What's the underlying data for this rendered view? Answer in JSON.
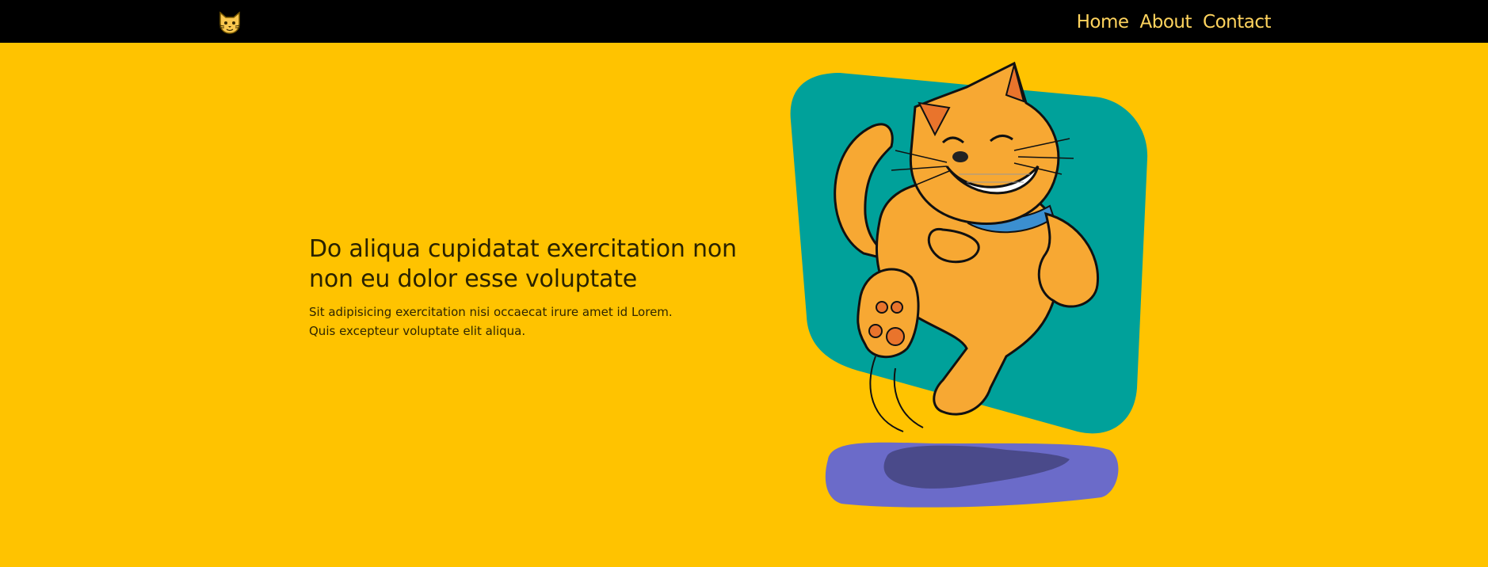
{
  "nav": {
    "logo_icon": "cat-face-icon",
    "links": [
      "Home",
      "About",
      "Contact"
    ]
  },
  "hero": {
    "title": "Do aliqua cupidatat exercitation non non eu dolor esse voluptate",
    "subtitle": "Sit adipisicing exercitation nisi occaecat irure amet id Lorem. Quis excepteur voluptate elit aliqua.",
    "illustration": "dancing-cat-illustration"
  },
  "colors": {
    "background": "#FFC300",
    "navbar": "#000000",
    "nav_link": "#FFD45E",
    "teal_panel": "#00A19A",
    "cat_orange": "#F7A833",
    "shadow_purple": "#6B6BC9"
  }
}
